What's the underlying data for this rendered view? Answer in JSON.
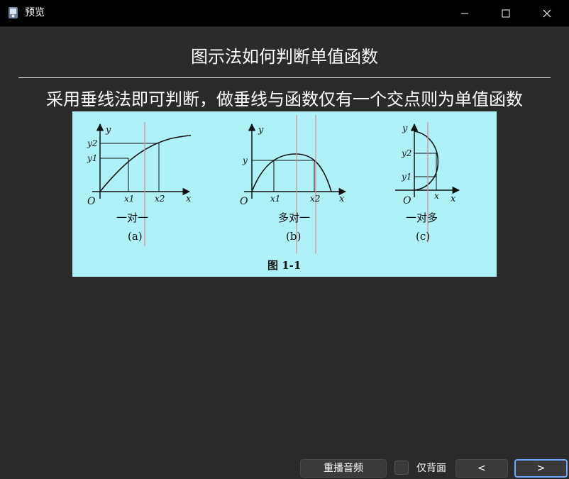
{
  "window": {
    "title": "预览",
    "app_icon": "app-icon",
    "controls": [
      "minimize-icon",
      "maximize-icon",
      "close-icon"
    ]
  },
  "main": {
    "title": "图示法如何判断单值函数",
    "subtitle": "采用垂线法即可判断，做垂线与函数仅有一个交点则为单值函数"
  },
  "figure": {
    "caption": "图 1-1",
    "background_color": "#aef2f8",
    "panels": [
      {
        "id": "a",
        "label": "(a)",
        "relation": "一对一",
        "axis_x": "x",
        "axis_y": "y",
        "origin": "O",
        "x_ticks": [
          "x1",
          "x2"
        ],
        "y_ticks": [
          "y1",
          "y2"
        ]
      },
      {
        "id": "b",
        "label": "(b)",
        "relation": "多对一",
        "axis_x": "x",
        "axis_y": "y",
        "origin": "O",
        "x_ticks": [
          "x1",
          "x2"
        ],
        "y_ticks": [
          "y"
        ]
      },
      {
        "id": "c",
        "label": "(c)",
        "relation": "一对多",
        "axis_x": "x",
        "axis_y": "y",
        "origin": "O",
        "x_ticks": [
          "x"
        ],
        "y_ticks": [
          "y2",
          "y1"
        ]
      }
    ],
    "vertical_line_color": "#e08a8a"
  },
  "footer": {
    "replay_label": "重播音频",
    "back_only_label": "仅背面",
    "back_only_checked": false,
    "prev_label": "<",
    "next_label": ">"
  }
}
